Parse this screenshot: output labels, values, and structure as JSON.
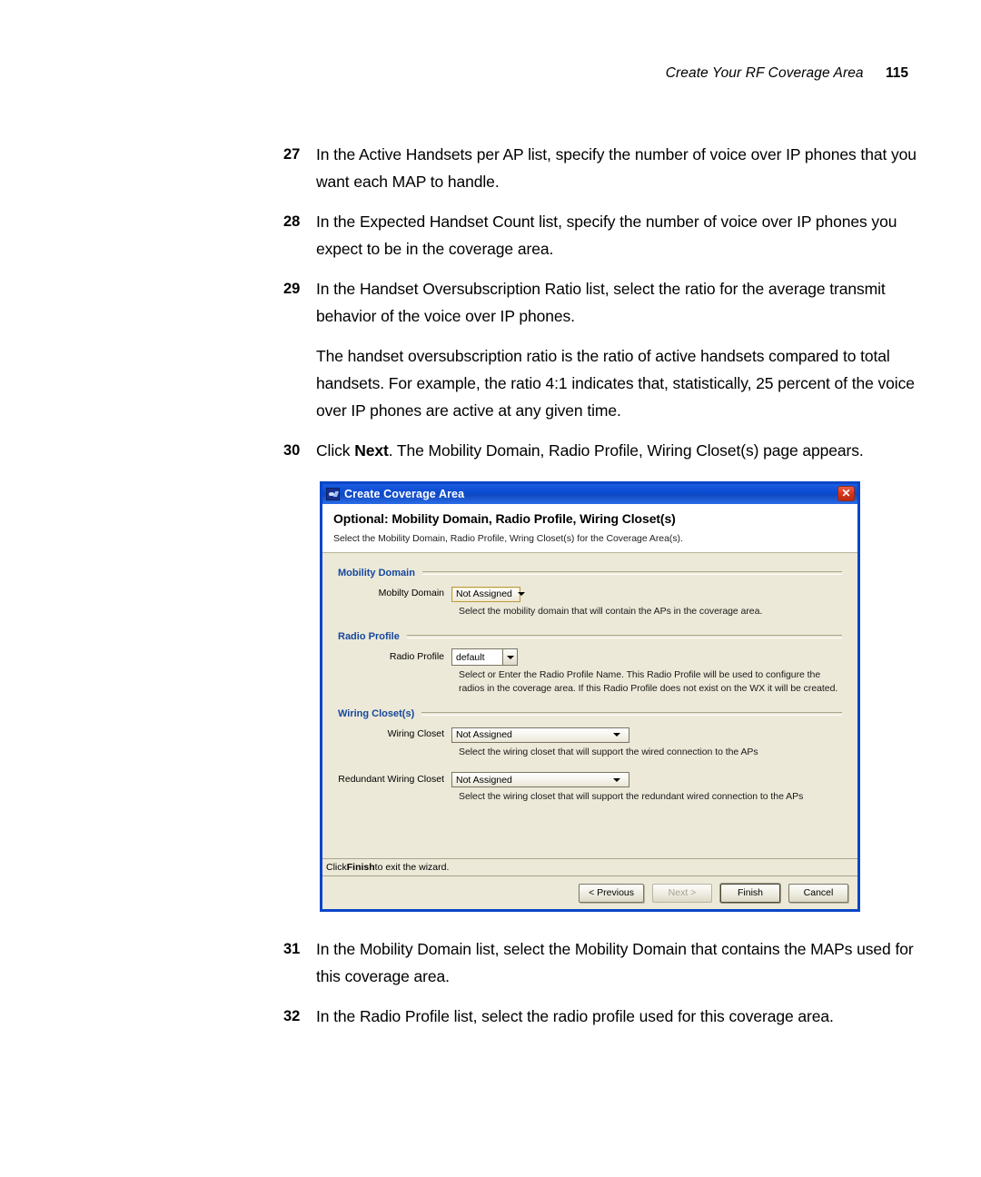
{
  "page_header": {
    "title": "Create Your RF Coverage Area",
    "page_number": "115"
  },
  "steps": [
    {
      "number": "27",
      "text": "In the Active Handsets per AP list, specify the number of voice over IP phones that you want each MAP to handle."
    },
    {
      "number": "28",
      "text": "In the Expected Handset Count list, specify the number of voice over IP phones you expect to be in the coverage area."
    },
    {
      "number": "29",
      "text": "In the Handset Oversubscription Ratio list, select the ratio for the average transmit behavior of the voice over IP phones."
    }
  ],
  "paragraph": "The handset oversubscription ratio is the ratio of active handsets compared to total handsets. For example, the ratio 4:1 indicates that, statistically, 25 percent of the voice over IP phones are active at any given time.",
  "step30": {
    "number": "30",
    "text_before": "Click ",
    "bold": "Next",
    "text_after": ". The Mobility Domain, Radio Profile, Wiring Closet(s) page appears."
  },
  "steps_after": [
    {
      "number": "31",
      "text": "In the Mobility Domain list, select the Mobility Domain that contains the MAPs used for this coverage area."
    },
    {
      "number": "32",
      "text": "In the Radio Profile list, select the radio profile used for this coverage area."
    }
  ],
  "dialog": {
    "title": "Create Coverage Area",
    "close_label": "✕",
    "heading": "Optional: Mobility Domain, Radio Profile, Wiring Closet(s)",
    "subheading": "Select the Mobility Domain, Radio Profile, Wring Closet(s) for the Coverage Area(s).",
    "groups": [
      {
        "label": "Mobility Domain",
        "fields": [
          {
            "label": "Mobilty Domain",
            "value": "Not Assigned",
            "help": "Select the mobility domain that will contain  the APs in the coverage area."
          }
        ]
      },
      {
        "label": "Radio Profile",
        "fields": [
          {
            "label": "Radio Profile",
            "value": "default",
            "help": "Select or Enter the Radio Profile Name. This Radio Profile will be used to configure the radios in the coverage area. If this Radio Profile does not exist on the WX it will be created."
          }
        ]
      },
      {
        "label": "Wiring Closet(s)",
        "fields": [
          {
            "label": "Wiring Closet",
            "value": "Not Assigned",
            "help": "Select the wiring closet that will support the wired connection to the APs"
          },
          {
            "label": "Redundant Wiring Closet",
            "value": "Not Assigned",
            "help": "Select the wiring closet that will support the redundant wired connection to the APs"
          }
        ]
      }
    ],
    "statusbar": {
      "before": "Click ",
      "bold": "Finish",
      "after": " to exit the wizard."
    },
    "buttons": [
      {
        "label": "< Previous",
        "state": "enabled"
      },
      {
        "label": "Next >",
        "state": "disabled"
      },
      {
        "label": "Finish",
        "state": "default"
      },
      {
        "label": "Cancel",
        "state": "enabled"
      }
    ],
    "colors": {
      "titlebar": "#0a4ad0",
      "border": "#0a46c8",
      "background": "#ece9d8",
      "group_label": "#15479e",
      "close_button": "#d8341c"
    }
  }
}
